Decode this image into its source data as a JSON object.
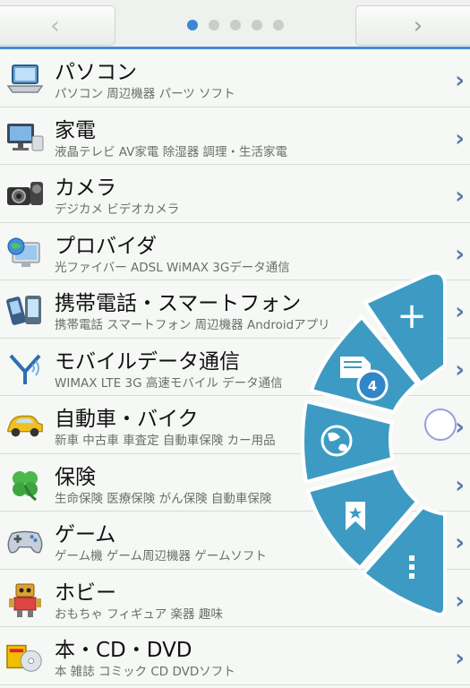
{
  "nav": {
    "prev_glyph": "‹",
    "next_glyph": "›",
    "page_count": 5,
    "active_page": 1
  },
  "items": [
    {
      "title": "パソコン",
      "subtitle": "パソコン 周辺機器 パーツ ソフト",
      "icon": "laptop-icon"
    },
    {
      "title": "家電",
      "subtitle": "液晶テレビ AV家電 除湿器 調理・生活家電",
      "icon": "tv-icon"
    },
    {
      "title": "カメラ",
      "subtitle": "デジカメ ビデオカメラ",
      "icon": "camera-icon"
    },
    {
      "title": "プロバイダ",
      "subtitle": "光ファイバー ADSL WiMAX 3Gデータ通信",
      "icon": "globe-computer-icon"
    },
    {
      "title": "携帯電話・スマートフォン",
      "subtitle": "携帯電話 スマートフォン 周辺機器 Androidアプリ",
      "icon": "mobile-phone-icon"
    },
    {
      "title": "モバイルデータ通信",
      "subtitle": "WIMAX LTE 3G 高速モバイル データ通信",
      "icon": "antenna-icon"
    },
    {
      "title": "自動車・バイク",
      "subtitle": "新車 中古車 車査定 自動車保険 カー用品",
      "icon": "car-icon"
    },
    {
      "title": "保険",
      "subtitle": "生命保険 医療保険 がん保険 自動車保険",
      "icon": "clover-icon"
    },
    {
      "title": "ゲーム",
      "subtitle": "ゲーム機 ゲーム周辺機器 ゲームソフト",
      "icon": "gamepad-icon"
    },
    {
      "title": "ホビー",
      "subtitle": "おもちゃ フィギュア 楽器 趣味",
      "icon": "robot-icon"
    },
    {
      "title": "本・CD・DVD",
      "subtitle": "本 雑誌 コミック CD DVDソフト",
      "icon": "book-cd-icon"
    }
  ],
  "radial_menu": {
    "add_glyph": "+",
    "badge_count": "4",
    "more_glyph": "⋮",
    "color": "#3b9bc2"
  }
}
